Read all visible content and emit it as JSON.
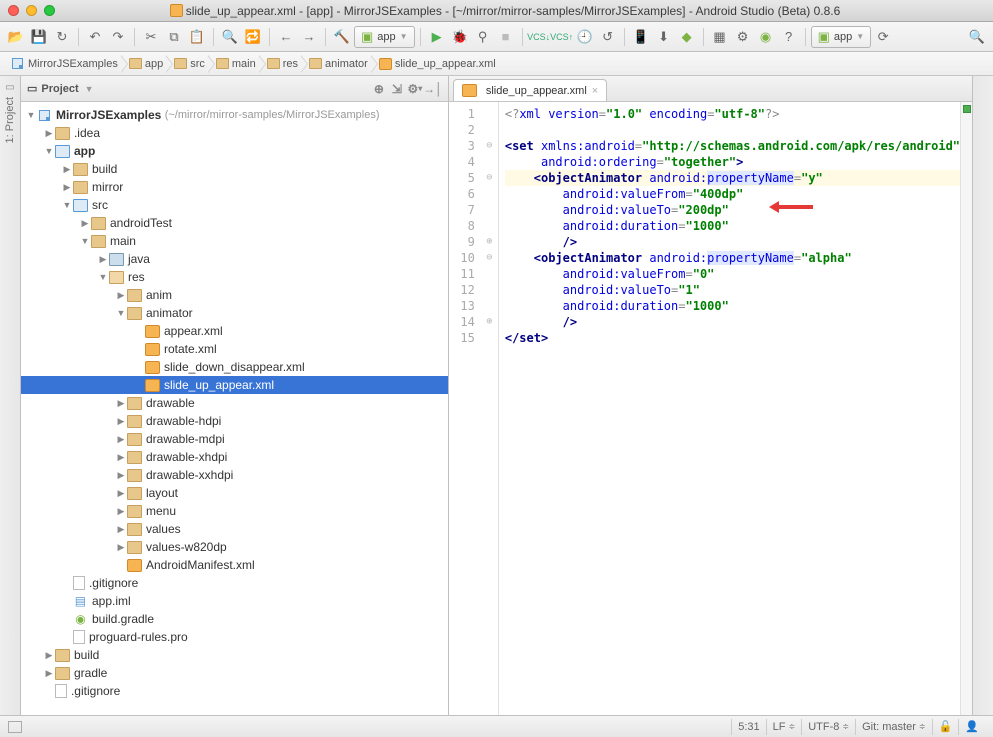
{
  "window": {
    "title": "slide_up_appear.xml - [app] - MirrorJSExamples - [~/mirror/mirror-samples/MirrorJSExamples] - Android Studio (Beta) 0.8.6"
  },
  "runconfig": {
    "name": "app"
  },
  "runconfig2": {
    "name": "app"
  },
  "breadcrumbs": [
    "MirrorJSExamples",
    "app",
    "src",
    "main",
    "res",
    "animator",
    "slide_up_appear.xml"
  ],
  "panel": {
    "title": "Project"
  },
  "railLabel": "1: Project",
  "tree": {
    "root": "MirrorJSExamples",
    "rootPath": "(~/mirror/mirror-samples/MirrorJSExamples)",
    "nodes": [
      ".idea",
      "app",
      "build",
      "mirror",
      "src",
      "androidTest",
      "main",
      "java",
      "res",
      "anim",
      "animator",
      "appear.xml",
      "rotate.xml",
      "slide_down_disappear.xml",
      "slide_up_appear.xml",
      "drawable",
      "drawable-hdpi",
      "drawable-mdpi",
      "drawable-xhdpi",
      "drawable-xxhdpi",
      "layout",
      "menu",
      "values",
      "values-w820dp",
      "AndroidManifest.xml",
      ".gitignore",
      "app.iml",
      "build.gradle",
      "proguard-rules.pro",
      "build",
      "gradle",
      ".gitignore"
    ]
  },
  "editorTab": "slide_up_appear.xml",
  "code": {
    "lineNumbers": [
      "1",
      "2",
      "3",
      "4",
      "5",
      "6",
      "7",
      "8",
      "9",
      "10",
      "11",
      "12",
      "13",
      "14",
      "15"
    ],
    "lines": [
      {
        "t": [
          [
            "proc",
            "<?"
          ],
          [
            "attr",
            "xml version"
          ],
          [
            "proc",
            "="
          ],
          [
            "str",
            "\"1.0\""
          ],
          [
            "attr",
            " encoding"
          ],
          [
            "proc",
            "="
          ],
          [
            "str",
            "\"utf-8\""
          ],
          [
            "proc",
            "?>"
          ]
        ]
      },
      {
        "t": [
          [
            "",
            "  "
          ]
        ]
      },
      {
        "t": [
          [
            "tag",
            "<set "
          ],
          [
            "attr",
            "xmlns:android"
          ],
          [
            "proc",
            "="
          ],
          [
            "str",
            "\"http://schemas.android.com/apk/res/android\""
          ]
        ]
      },
      {
        "t": [
          [
            "",
            "     "
          ],
          [
            "attr",
            "android:ordering"
          ],
          [
            "proc",
            "="
          ],
          [
            "str",
            "\"together\""
          ],
          [
            "tag",
            ">"
          ]
        ]
      },
      {
        "hl": true,
        "t": [
          [
            "",
            "    "
          ],
          [
            "tag",
            "<objectAnimator "
          ],
          [
            "attr",
            "android:"
          ],
          [
            "attr-hl",
            "propertyName"
          ],
          [
            "proc",
            "="
          ],
          [
            "str",
            "\"y\""
          ]
        ]
      },
      {
        "t": [
          [
            "",
            "        "
          ],
          [
            "attr",
            "android:valueFrom"
          ],
          [
            "proc",
            "="
          ],
          [
            "str",
            "\"400dp\""
          ]
        ]
      },
      {
        "t": [
          [
            "",
            "        "
          ],
          [
            "attr",
            "android:valueTo"
          ],
          [
            "proc",
            "="
          ],
          [
            "str",
            "\"200dp\""
          ]
        ]
      },
      {
        "t": [
          [
            "",
            "        "
          ],
          [
            "attr",
            "android:duration"
          ],
          [
            "proc",
            "="
          ],
          [
            "str",
            "\"1000\""
          ]
        ]
      },
      {
        "t": [
          [
            "",
            "        "
          ],
          [
            "tag",
            "/>"
          ]
        ]
      },
      {
        "t": [
          [
            "",
            "    "
          ],
          [
            "tag",
            "<objectAnimator "
          ],
          [
            "attr",
            "android:"
          ],
          [
            "attr-hl",
            "propertyName"
          ],
          [
            "proc",
            "="
          ],
          [
            "str",
            "\"alpha\""
          ]
        ]
      },
      {
        "t": [
          [
            "",
            "        "
          ],
          [
            "attr",
            "android:valueFrom"
          ],
          [
            "proc",
            "="
          ],
          [
            "str",
            "\"0\""
          ]
        ]
      },
      {
        "t": [
          [
            "",
            "        "
          ],
          [
            "attr",
            "android:valueTo"
          ],
          [
            "proc",
            "="
          ],
          [
            "str",
            "\"1\""
          ]
        ]
      },
      {
        "t": [
          [
            "",
            "        "
          ],
          [
            "attr",
            "android:duration"
          ],
          [
            "proc",
            "="
          ],
          [
            "str",
            "\"1000\""
          ]
        ]
      },
      {
        "t": [
          [
            "",
            "        "
          ],
          [
            "tag",
            "/>"
          ]
        ]
      },
      {
        "t": [
          [
            "tag",
            "</set>"
          ]
        ]
      }
    ]
  },
  "status": {
    "pos": "5:31",
    "le": "LF",
    "enc": "UTF-8",
    "git": "Git: master"
  }
}
